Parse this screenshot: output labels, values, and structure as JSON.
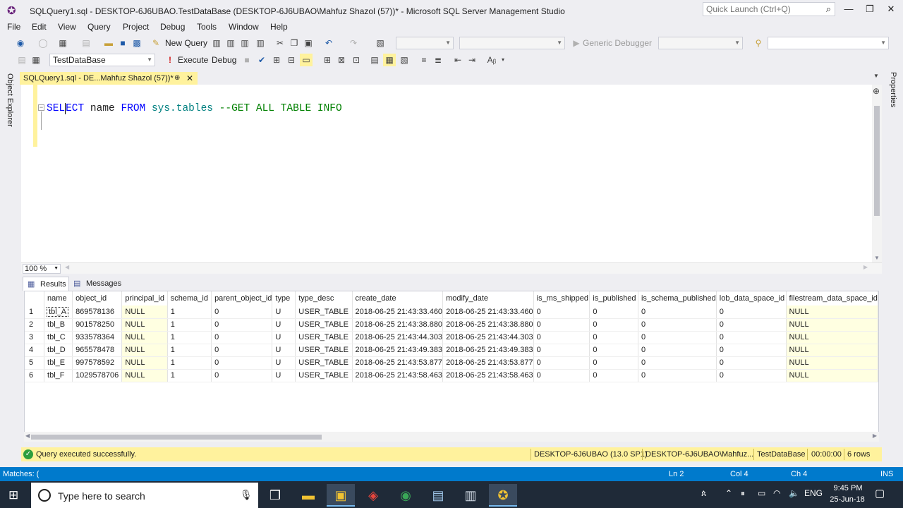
{
  "window": {
    "title": "SQLQuery1.sql - DESKTOP-6J6UBAO.TestDataBase (DESKTOP-6J6UBAO\\Mahfuz Shazol (57))* - Microsoft SQL Server Management Studio",
    "quick_launch_placeholder": "Quick Launch (Ctrl+Q)"
  },
  "menu": [
    "File",
    "Edit",
    "View",
    "Query",
    "Project",
    "Debug",
    "Tools",
    "Window",
    "Help"
  ],
  "toolbar1": {
    "new_query_label": "New Query",
    "debugger_label": "Generic Debugger"
  },
  "toolbar2": {
    "database": "TestDataBase",
    "execute_label": "Execute",
    "debug_label": "Debug"
  },
  "side_panels": {
    "left": "Object Explorer",
    "right": "Properties"
  },
  "document_tab": {
    "label": "SQLQuery1.sql - DE...Mahfuz Shazol (57))*"
  },
  "editor": {
    "keyword_select_a": "SEL",
    "keyword_select_b": "ECT",
    "col": "name",
    "keyword_from": "FROM",
    "object": "sys.tables",
    "comment": "--GET ALL TABLE INFO"
  },
  "zoom": "100 %",
  "results_tabs": [
    "Results",
    "Messages"
  ],
  "results": {
    "columns": [
      "name",
      "object_id",
      "principal_id",
      "schema_id",
      "parent_object_id",
      "type",
      "type_desc",
      "create_date",
      "modify_date",
      "is_ms_shipped",
      "is_published",
      "is_schema_published",
      "lob_data_space_id",
      "filestream_data_space_id"
    ],
    "rows": [
      [
        "1",
        "tbl_A",
        "869578136",
        "NULL",
        "1",
        "0",
        "U",
        "USER_TABLE",
        "2018-06-25 21:43:33.460",
        "2018-06-25 21:43:33.460",
        "0",
        "0",
        "0",
        "0",
        "NULL"
      ],
      [
        "2",
        "tbl_B",
        "901578250",
        "NULL",
        "1",
        "0",
        "U",
        "USER_TABLE",
        "2018-06-25 21:43:38.880",
        "2018-06-25 21:43:38.880",
        "0",
        "0",
        "0",
        "0",
        "NULL"
      ],
      [
        "3",
        "tbl_C",
        "933578364",
        "NULL",
        "1",
        "0",
        "U",
        "USER_TABLE",
        "2018-06-25 21:43:44.303",
        "2018-06-25 21:43:44.303",
        "0",
        "0",
        "0",
        "0",
        "NULL"
      ],
      [
        "4",
        "tbl_D",
        "965578478",
        "NULL",
        "1",
        "0",
        "U",
        "USER_TABLE",
        "2018-06-25 21:43:49.383",
        "2018-06-25 21:43:49.383",
        "0",
        "0",
        "0",
        "0",
        "NULL"
      ],
      [
        "5",
        "tbl_E",
        "997578592",
        "NULL",
        "1",
        "0",
        "U",
        "USER_TABLE",
        "2018-06-25 21:43:53.877",
        "2018-06-25 21:43:53.877",
        "0",
        "0",
        "0",
        "0",
        "NULL"
      ],
      [
        "6",
        "tbl_F",
        "1029578706",
        "NULL",
        "1",
        "0",
        "U",
        "USER_TABLE",
        "2018-06-25 21:43:58.463",
        "2018-06-25 21:43:58.463",
        "0",
        "0",
        "0",
        "0",
        "NULL"
      ]
    ]
  },
  "query_status": {
    "message": "Query executed successfully.",
    "server": "DESKTOP-6J6UBAO (13.0 SP1)",
    "user": "DESKTOP-6J6UBAO\\Mahfuz...",
    "database": "TestDataBase",
    "elapsed": "00:00:00",
    "rows": "6 rows"
  },
  "status_bar": {
    "left": "Matches: (",
    "ln": "Ln 2",
    "col": "Col 4",
    "ch": "Ch 4",
    "mode": "INS"
  },
  "taskbar": {
    "search_placeholder": "Type here to search",
    "lang": "ENG",
    "time": "9:45 PM",
    "date": "25-Jun-18"
  },
  "colors": {
    "accent": "#007acc",
    "doc_tab": "#fff29d",
    "keyword": "#0000ff",
    "object": "#008080",
    "comment": "#008000"
  }
}
